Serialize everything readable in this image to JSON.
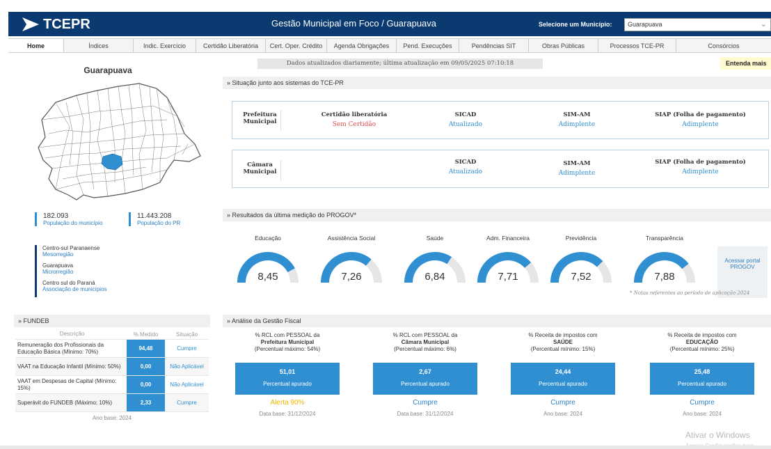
{
  "header": {
    "logo": "TCEPR",
    "title": "Gestão Municipal em Foco / Guarapuava",
    "select_label": "Selecione um Município:",
    "select_value": "Guarapuava"
  },
  "nav": {
    "tabs": [
      "Home",
      "Índices",
      "Indic. Exercício",
      "Certidão Liberatória",
      "Cert. Oper. Crédito",
      "Agenda Obrigações",
      "Pend. Execuções",
      "Pendências SIT",
      "Obras Públicas",
      "Processos TCE-PR",
      "Consórcios"
    ]
  },
  "updated_text": "Dados atualizados diariamente; última atualização em 09/05/2025 07:10:18",
  "entenda": "Entenda mais",
  "municipality": {
    "name": "Guarapuava",
    "population": "182.093",
    "population_label": "População do município",
    "pr_population": "11.443.208",
    "pr_population_label": "População do PR",
    "meso": "Centro-sul Paranaense",
    "meso_label": "Mesorregião",
    "micro": "Guarapuava",
    "micro_label": "Microrregião",
    "assoc": "Centro sul do Paraná",
    "assoc_label": "Associação de municípios"
  },
  "situacao": {
    "title": "» Situação junto aos sistemas do TCE-PR",
    "prefeitura": {
      "entity": "Prefeitura Municipal",
      "certidao_label": "Certidão liberatória",
      "certidao_status": "Sem Certidão",
      "sicad_label": "SICAD",
      "sicad_status": "Atualizado",
      "simam_label": "SIM-AM",
      "simam_status": "Adimplente",
      "siap_label": "SIAP (Folha de pagamento)",
      "siap_status": "Adimplente"
    },
    "camara": {
      "entity": "Câmara Municipal",
      "sicad_label": "SICAD",
      "sicad_status": "Atualizado",
      "simam_label": "SIM-AM",
      "simam_status": "Adimplente",
      "siap_label": "SIAP (Folha de pagamento)",
      "siap_status": "Adimplente"
    }
  },
  "progov": {
    "title": "» Resultados da última medição do PROGOV*",
    "max_score": 10,
    "items": [
      {
        "label": "Educação",
        "value": "8,45",
        "score": 8.45
      },
      {
        "label": "Assistência Social",
        "value": "7,26",
        "score": 7.26
      },
      {
        "label": "Saúde",
        "value": "6,84",
        "score": 6.84
      },
      {
        "label": "Adm. Financeira",
        "value": "7,71",
        "score": 7.71
      },
      {
        "label": "Previdência",
        "value": "7,52",
        "score": 7.52
      },
      {
        "label": "Transparência",
        "value": "7,88",
        "score": 7.88
      }
    ],
    "portal_link": "Acessar portal PROGOV",
    "note": "* Notas referentes ao período de aplicação 2024"
  },
  "fundeb": {
    "title": "» FUNDEB",
    "headers": [
      "Descrição",
      "% Medido",
      "Situação"
    ],
    "rows": [
      {
        "desc": "Remuneração dos Profissionais da Educação Básica (Mínimo: 70%)",
        "value": "94,48",
        "status": "Cumpre"
      },
      {
        "desc": "VAAT na Educação Infantil (Mínimo: 50%)",
        "value": "0,00",
        "status": "Não Aplicável"
      },
      {
        "desc": "VAAT em Despesas de Capital (Mínimo: 15%)",
        "value": "0,00",
        "status": "Não Aplicável"
      },
      {
        "desc": "Superávit do FUNDEB (Máximo: 10%)",
        "value": "2,33",
        "status": "Cumpre"
      }
    ],
    "footer": "Ano base: 2024"
  },
  "fiscal": {
    "title": "» Análise da Gestão Fiscal",
    "cards": [
      {
        "line1": "% RCL com PESSOAL da",
        "line2": "Prefeitura Municipal",
        "limit": "(Percentual máximo: 54%)",
        "value": "51,01",
        "sub": "Percentual apurado",
        "status": "Alerta 90%",
        "base": "Data base: 31/12/2024"
      },
      {
        "line1": "% RCL com PESSOAL da",
        "line2": "Câmara Municipal",
        "limit": "(Percentual máximo: 6%)",
        "value": "2,67",
        "sub": "Percentual apurado",
        "status": "Cumpre",
        "base": "Data base: 31/12/2024"
      },
      {
        "line1": "% Receita de impostos com",
        "line2": "SAÚDE",
        "limit": "(Percentual mínimo: 15%)",
        "value": "24,44",
        "sub": "Percentual apurado",
        "status": "Cumpre",
        "base": "Ano base: 2024"
      },
      {
        "line1": "% Receita de impostos com",
        "line2": "EDUCAÇÃO",
        "limit": "(Percentual mínimo: 25%)",
        "value": "25,48",
        "sub": "Percentual apurado",
        "status": "Cumpre",
        "base": "Ano base: 2024"
      }
    ]
  },
  "watermark": {
    "line1": "Ativar o Windows",
    "line2": "Acesse Configurações para"
  },
  "colors": {
    "navy": "#0b3a70",
    "blue": "#2f8fd1",
    "red": "#e24d4d",
    "warn": "#f0b400"
  }
}
